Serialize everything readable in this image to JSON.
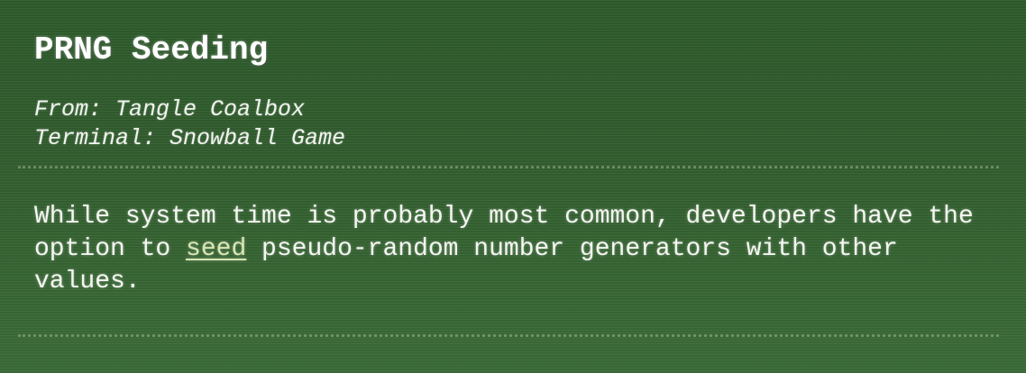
{
  "terminal": {
    "title": "PRNG Seeding",
    "from": "From: Tangle Coalbox",
    "terminal_name": "Terminal: Snowball Game",
    "message": {
      "before_link": "While system time is probably most common, developers have the option to ",
      "link_text": "seed",
      "after_link": " pseudo-random number generators with other values."
    }
  },
  "colors": {
    "background": "#335f30",
    "text": "#f4f6f1",
    "link": "#d9e6b2"
  }
}
